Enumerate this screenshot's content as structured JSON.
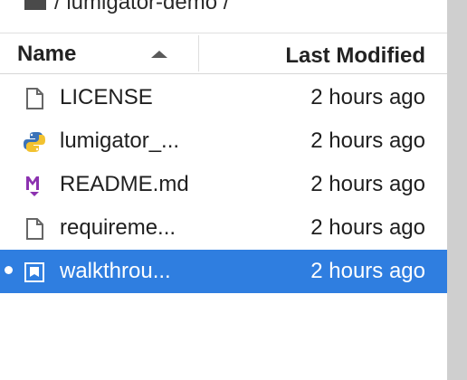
{
  "breadcrumb": {
    "path": "/ lumigator-demo /"
  },
  "header": {
    "name_label": "Name",
    "modified_label": "Last Modified"
  },
  "files": [
    {
      "name": "LICENSE",
      "modified": "2 hours ago",
      "icon": "file-icon"
    },
    {
      "name": "lumigator_...",
      "modified": "2 hours ago",
      "icon": "python-icon"
    },
    {
      "name": "README.md",
      "modified": "2 hours ago",
      "icon": "markdown-icon"
    },
    {
      "name": "requireme...",
      "modified": "2 hours ago",
      "icon": "file-icon"
    },
    {
      "name": "walkthrou...",
      "modified": "2 hours ago",
      "icon": "notebook-icon",
      "selected": true
    }
  ],
  "colors": {
    "selection": "#2f7ee0",
    "text": "#1f1f1f",
    "scrollbar": "#cfcfcf"
  }
}
